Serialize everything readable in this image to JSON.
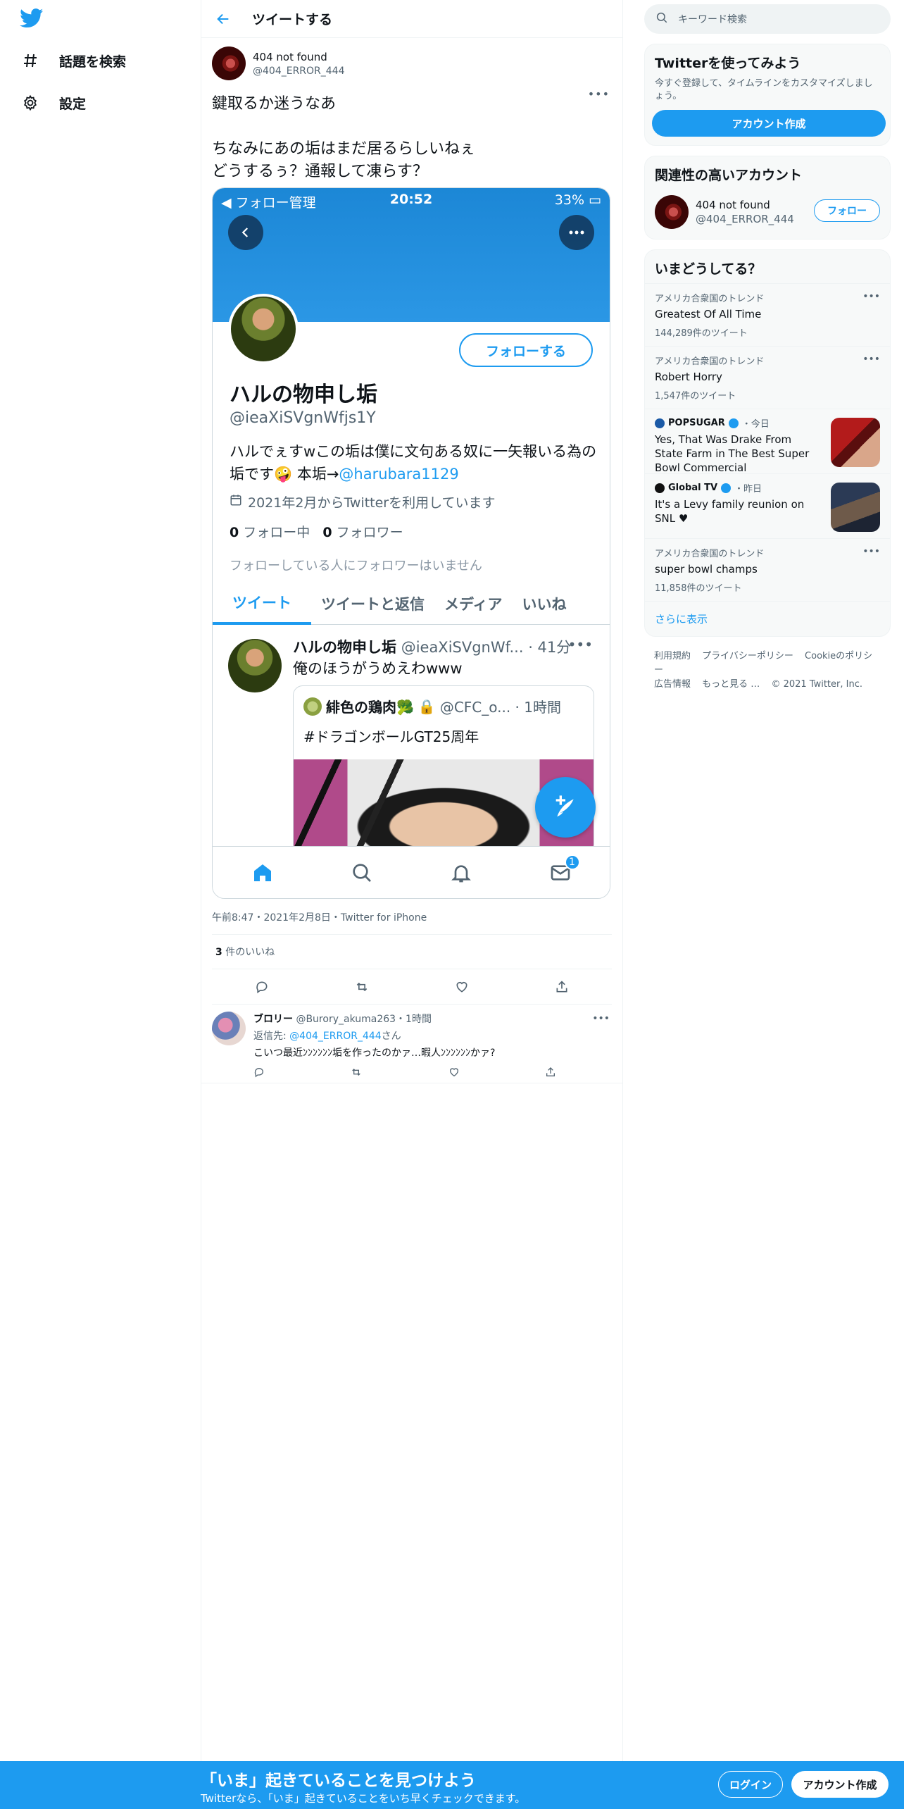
{
  "nav": {
    "explore_label": "話題を検索",
    "settings_label": "設定"
  },
  "header": {
    "title": "ツイートする"
  },
  "tweet": {
    "author_name": "404 not found",
    "author_handle": "@404_ERROR_444",
    "text": "鍵取るか迷うなあ\n\nちなみにあの垢はまだ居るらしいねぇ\nどうするぅ？通報して凍らす？",
    "meta": "午前8:47・2021年2月8日・Twitter for iPhone",
    "likes_count": "3",
    "likes_label": " 件のいいね"
  },
  "screenshot": {
    "status_left": "◀ フォロー管理",
    "status_time": "20:52",
    "status_right": "33%",
    "follow_button": "フォローする",
    "profile_name": "ハルの物申し垢",
    "profile_handle": "@ieaXiSVgnWfjs1Y",
    "bio_text": "ハルでぇすwこの垢は僕に文句ある奴に一矢報いる為の垢です🤪 本垢→",
    "bio_link": "@harubara1129",
    "joined": "2021年2月からTwitterを利用しています",
    "following_count": "0",
    "following_label": " フォロー中",
    "followers_count": "0",
    "followers_label": " フォロワー",
    "no_followers_note": "フォローしている人にフォロワーはいません",
    "tabs": [
      "ツイート",
      "ツイートと返信",
      "メディア",
      "いいね"
    ],
    "inner_tweet_name": "ハルの物申し垢",
    "inner_tweet_handle_time": "@ieaXiSVgnWf... · 41分",
    "inner_tweet_text": "俺のほうがうめえわwww",
    "quote_name": "緋色の鶏肉🥦",
    "quote_handle_time": "@CFC_o... · 1時間",
    "quote_text": "#ドラゴンボールGT25周年",
    "mail_badge": "1"
  },
  "reply": {
    "name": "ブロリー",
    "handle_time": "@Burory_akuma263・1時間",
    "reply_to_prefix": "返信先: ",
    "reply_to_handle": "@404_ERROR_444",
    "reply_to_suffix": "さん",
    "text": "こいつ最近ﾝﾝﾝﾝﾝﾝ垢を作ったのかァ…暇人ﾝﾝﾝﾝﾝﾝかァ?"
  },
  "sidebar": {
    "search_placeholder": "キーワード検索",
    "signup_card": {
      "title": "Twitterを使ってみよう",
      "subtitle": "今すぐ登録して、タイムラインをカスタマイズしましょう。",
      "button": "アカウント作成"
    },
    "related": {
      "title": "関連性の高いアカウント",
      "name": "404 not found",
      "handle": "@404_ERROR_444",
      "follow": "フォロー"
    },
    "trends": {
      "title": "いまどうしてる？",
      "items": [
        {
          "context": "アメリカ合衆国のトレンド",
          "name": "Greatest Of All Time",
          "count": "144,289件のツイート"
        },
        {
          "context": "アメリカ合衆国のトレンド",
          "name": "Robert Horry",
          "count": "1,547件のツイート"
        },
        {
          "source": "POPSUGAR",
          "time": "・今日",
          "name": "Yes, That Was Drake From State Farm in The Best Super Bowl Commercial"
        },
        {
          "source": "Global TV",
          "time": "・昨日",
          "name": "It's a Levy family reunion on SNL ♥"
        },
        {
          "context": "アメリカ合衆国のトレンド",
          "name": "super bowl champs",
          "count": "11,858件のツイート"
        }
      ],
      "show_more": "さらに表示"
    },
    "footer": [
      "利用規約",
      "プライバシーポリシー",
      "Cookieのポリシー",
      "広告情報",
      "もっと見る …",
      "© 2021 Twitter, Inc."
    ]
  },
  "banner": {
    "title": "「いま」起きていることを見つけよう",
    "subtitle": "Twitterなら、「いま」起きていることをいち早くチェックできます。",
    "login": "ログイン",
    "signup": "アカウント作成"
  },
  "colors": {
    "accent": "#1d9bf0",
    "text": "#0f1419",
    "secondary": "#536471"
  }
}
